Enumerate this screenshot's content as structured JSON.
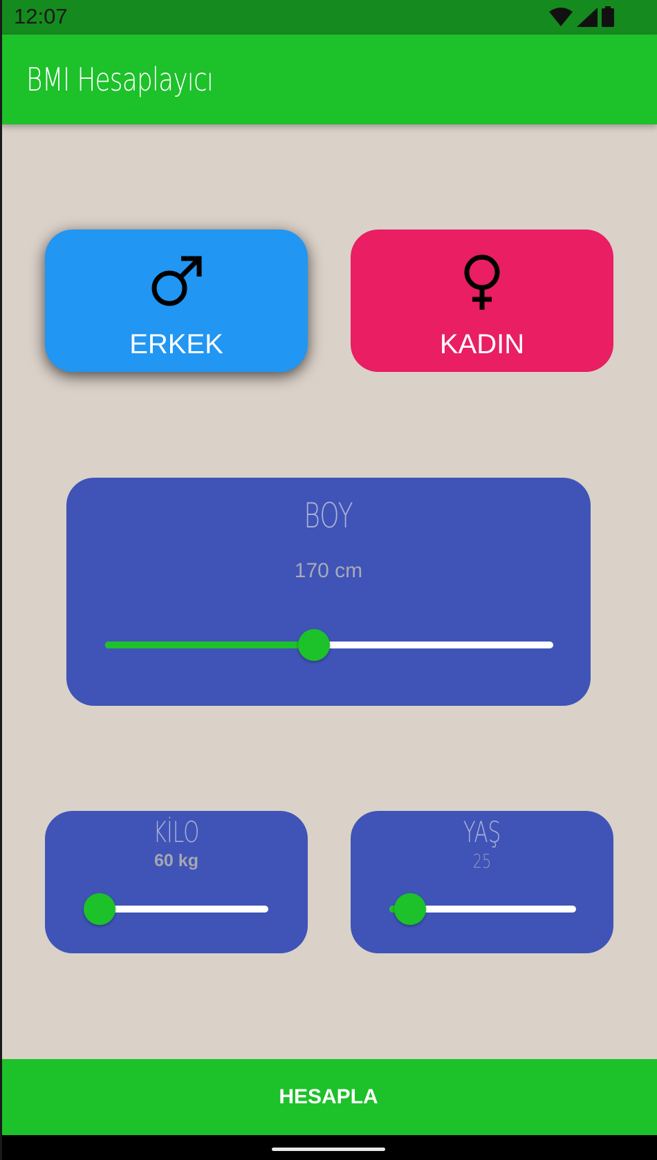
{
  "status_bar": {
    "time": "12:07",
    "icons": [
      "wifi-icon",
      "signal-icon",
      "battery-icon"
    ]
  },
  "app_bar": {
    "title": "BMI Hesaplayıcı"
  },
  "gender": {
    "male": {
      "label": "ERKEK",
      "icon": "♂",
      "selected": true
    },
    "female": {
      "label": "KADIN",
      "icon": "♀",
      "selected": false
    }
  },
  "boy": {
    "title": "BOY",
    "value_text": "170 cm",
    "slider_fraction": 0.466
  },
  "kilo": {
    "title": "KİLO",
    "value_text": "60 kg",
    "slider_fraction": 0.08
  },
  "yas": {
    "title": "YAŞ",
    "value_text": "25",
    "slider_fraction": 0.11
  },
  "action": {
    "label": "HESAPLA"
  },
  "colors": {
    "primary_green": "#1dc12a",
    "status_green": "#158a1e",
    "background": "#dad1c8",
    "male_blue": "#2196f3",
    "female_pink": "#e91e63",
    "card_indigo": "#3f54b6"
  }
}
